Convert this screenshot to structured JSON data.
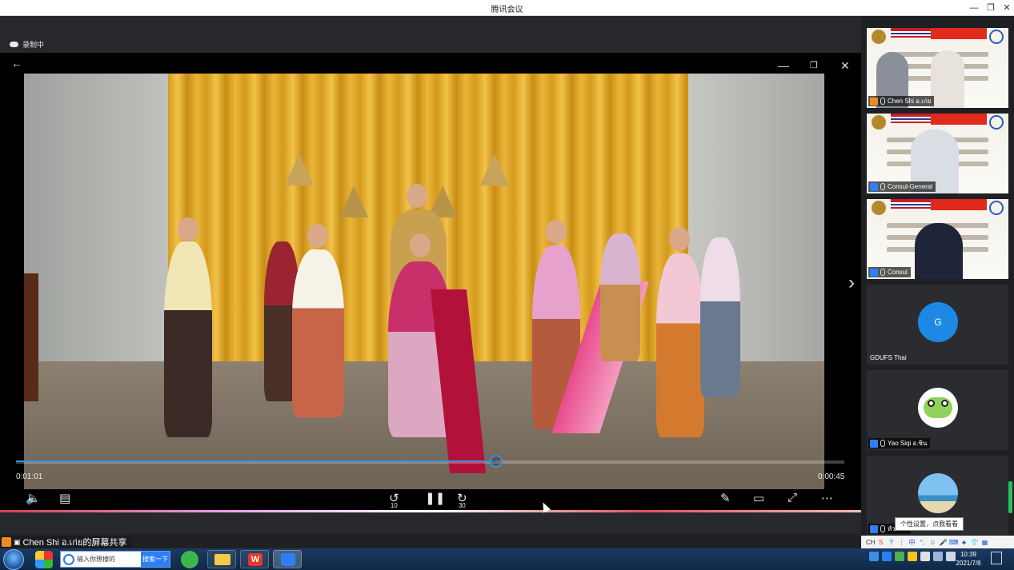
{
  "window": {
    "title": "腾讯会议",
    "minimize_icon": "minimize-icon",
    "restore_icon": "restore-icon",
    "close_icon": "close-icon"
  },
  "recording": {
    "label": "录制中"
  },
  "player": {
    "elapsed": "0:01:01",
    "remaining": "0:00:45",
    "progress_fraction": 0.58,
    "rewind_label": "10",
    "forward_label": "30",
    "accent": "#3a8ee6"
  },
  "share": {
    "label": "Chen Shi อ.เก่ย的屏幕共享"
  },
  "participants": [
    {
      "name": "Chen Shi อ.เก่ย",
      "type": "video"
    },
    {
      "name": "Consul-General",
      "type": "video"
    },
    {
      "name": "Consul",
      "type": "video"
    },
    {
      "name": "GDUFS Thai",
      "type": "avatar",
      "initial": "G",
      "color": "#1e88e5"
    },
    {
      "name": "Yao Siqi อ.ซิน",
      "type": "avatar"
    },
    {
      "name": "หัวหน้า",
      "type": "avatar"
    }
  ],
  "tooltip": {
    "text": "个性设置，点我看看"
  },
  "ime": {
    "lang": "CH",
    "mode": "中"
  },
  "taskbar": {
    "search_placeholder": "输入你想搜的",
    "search_button": "搜索一下",
    "time": "10:39",
    "date": "2021/7/8"
  }
}
